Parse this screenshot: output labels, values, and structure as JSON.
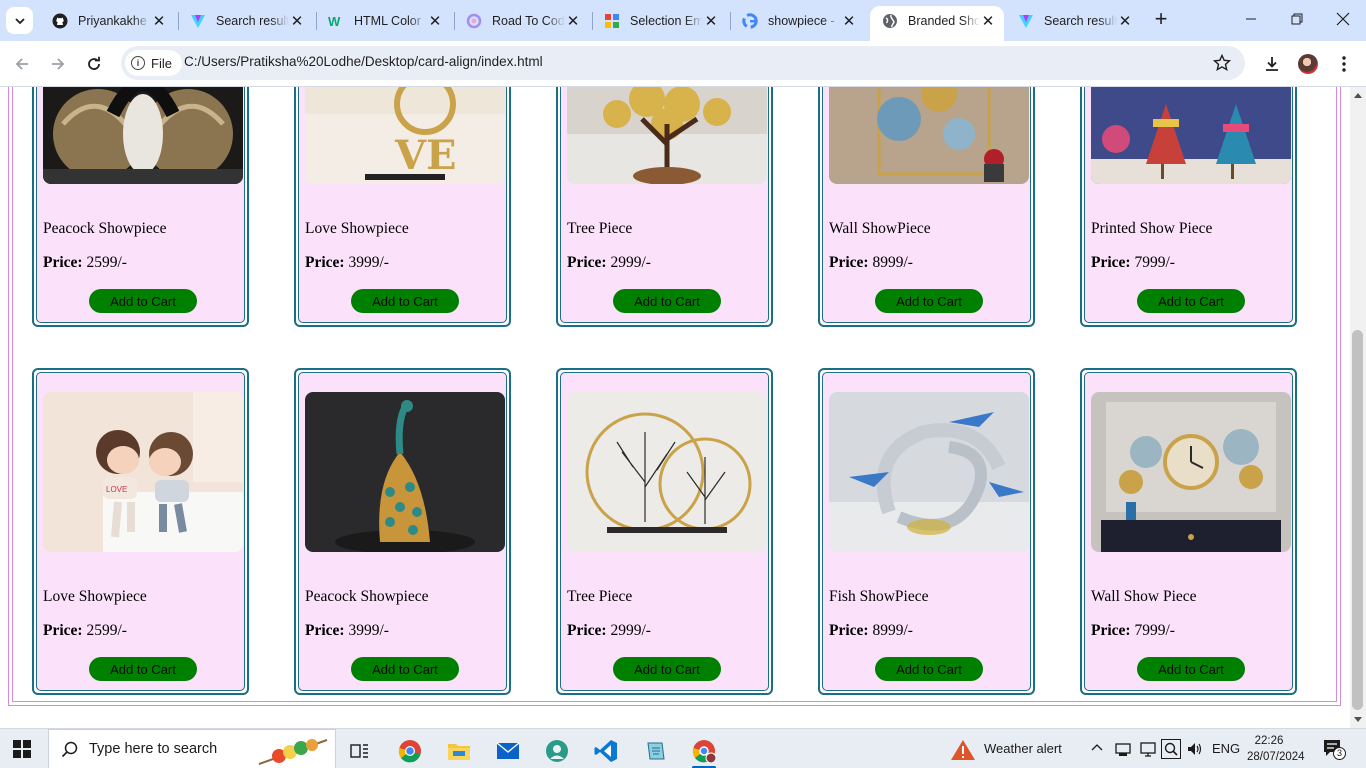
{
  "browser": {
    "tabs": [
      {
        "title": "Priyankakhe",
        "icon": "github-icon"
      },
      {
        "title": "Search result",
        "icon": "vite-icon"
      },
      {
        "title": "HTML Color",
        "icon": "w3-icon"
      },
      {
        "title": "Road To Cod",
        "icon": "roadmap-icon"
      },
      {
        "title": "Selection Em",
        "icon": "sheets-icon"
      },
      {
        "title": "showpiece -",
        "icon": "google-icon"
      },
      {
        "title": "Branded Sho",
        "icon": "globe-icon",
        "active": true
      },
      {
        "title": "Search result",
        "icon": "vite-icon"
      }
    ],
    "address": {
      "scheme_label": "File",
      "url": "C:/Users/Pratiksha%20Lodhe/Desktop/card-align/index.html"
    }
  },
  "products": [
    {
      "name": "Peacock Showpiece",
      "price_label": "Price:",
      "price": "2599/-",
      "button": "Add to Cart",
      "image": "peacock-wings"
    },
    {
      "name": "Love Showpiece",
      "price_label": "Price:",
      "price": "3999/-",
      "button": "Add to Cart",
      "image": "love-sculpture"
    },
    {
      "name": "Tree Piece",
      "price_label": "Price:",
      "price": "2999/-",
      "button": "Add to Cart",
      "image": "golden-tree"
    },
    {
      "name": "Wall ShowPiece",
      "price_label": "Price:",
      "price": "8999/-",
      "button": "Add to Cart",
      "image": "wall-flowers"
    },
    {
      "name": "Printed Show Piece",
      "price_label": "Price:",
      "price": "7999/-",
      "button": "Add to Cart",
      "image": "painted-dolls"
    },
    {
      "name": "Love Showpiece",
      "price_label": "Price:",
      "price": "2599/-",
      "button": "Add to Cart",
      "image": "kissing-couple"
    },
    {
      "name": "Peacock Showpiece",
      "price_label": "Price:",
      "price": "3999/-",
      "button": "Add to Cart",
      "image": "peacock-statue"
    },
    {
      "name": "Tree Piece",
      "price_label": "Price:",
      "price": "2999/-",
      "button": "Add to Cart",
      "image": "ring-trees"
    },
    {
      "name": "Fish ShowPiece",
      "price_label": "Price:",
      "price": "8999/-",
      "button": "Add to Cart",
      "image": "glass-dolphins"
    },
    {
      "name": "Wall Show Piece",
      "price_label": "Price:",
      "price": "7999/-",
      "button": "Add to Cart",
      "image": "wall-clock"
    }
  ],
  "taskbar": {
    "search_placeholder": "Type here to search",
    "weather": "Weather alert",
    "language": "ENG",
    "time": "22:26",
    "date": "28/07/2024",
    "notification_count": "3",
    "apps": [
      "task-view-icon",
      "chrome-icon",
      "file-explorer-icon",
      "mail-icon",
      "edge-canary-icon",
      "vscode-icon",
      "notepad-icon",
      "chrome-profile-icon"
    ]
  },
  "colors": {
    "card_bg": "#fce1fb",
    "card_border": "#1a6f86",
    "button_bg": "#008000",
    "tabstrip_bg": "#d3e3fd"
  }
}
